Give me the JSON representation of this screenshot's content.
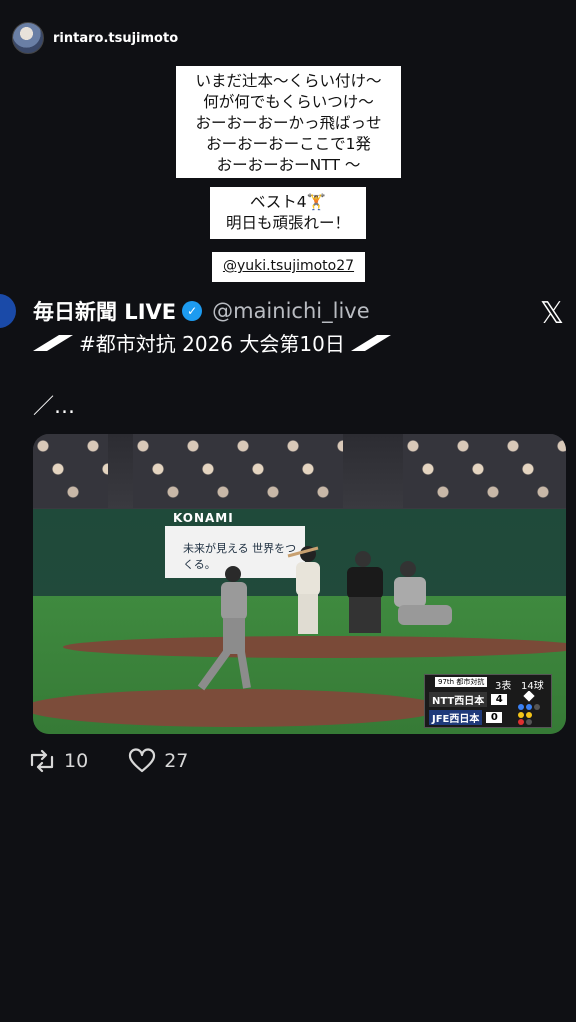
{
  "header": {
    "username": "rintaro.tsujimoto"
  },
  "stickers": {
    "message_lines": [
      "いまだ辻本〜くらい付け〜",
      "何が何でもくらいつけ〜",
      "おーおーおーかっ飛ばっせ",
      "おーおーおーここで1発",
      "おーおーおーNTT 〜"
    ],
    "best4_line1": "ベスト4🏋",
    "best4_line2": "明日も頑張れー！",
    "mention": "@yuki.tsujimoto27"
  },
  "post": {
    "author": "毎日新聞 LIVE",
    "verified_icon": "verified-badge-icon",
    "handle": "@mainichi_live",
    "hashtag_line": "#都市対抗 2026 大会第10日",
    "text": "／…",
    "platform_icon": "x-logo-icon"
  },
  "video": {
    "board_brand": "KONAMI",
    "board_text": "未来が見える 世界をつくる。",
    "scoreboard": {
      "tournament": "97th 都市対抗",
      "inning": "3表",
      "pitch_count": "14球",
      "teams": [
        {
          "name": "NTT西日本",
          "score": "4"
        },
        {
          "name": "JFE西日本",
          "score": "0"
        }
      ]
    }
  },
  "actions": {
    "repost_count": "10",
    "like_count": "27"
  }
}
